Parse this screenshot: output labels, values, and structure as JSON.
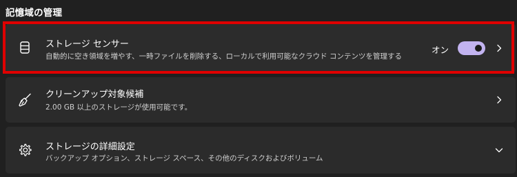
{
  "section": {
    "title": "記憶域の管理"
  },
  "colors": {
    "background": "#202020",
    "card": "#2b2b2b",
    "highlight": "#e00000",
    "toggle_on": "#c2b3f0"
  },
  "items": [
    {
      "icon": "storage-drive-icon",
      "title": "ストレージ センサー",
      "subtitle": "自動的に空き領域を増やす、一時ファイルを削除する、ローカルで利用可能なクラウド コンテンツを管理する",
      "toggle_label": "オン",
      "toggle_on": true,
      "action_icon": "chevron-right-icon"
    },
    {
      "icon": "broom-icon",
      "title": "クリーンアップ対象候補",
      "subtitle": "2.00 GB 以上のストレージが使用可能です。",
      "action_icon": "chevron-right-icon"
    },
    {
      "icon": "gear-icon",
      "title": "ストレージの詳細設定",
      "subtitle": "バックアップ オプション、ストレージ スペース、その他のディスクおよびボリューム",
      "action_icon": "chevron-down-icon"
    }
  ]
}
